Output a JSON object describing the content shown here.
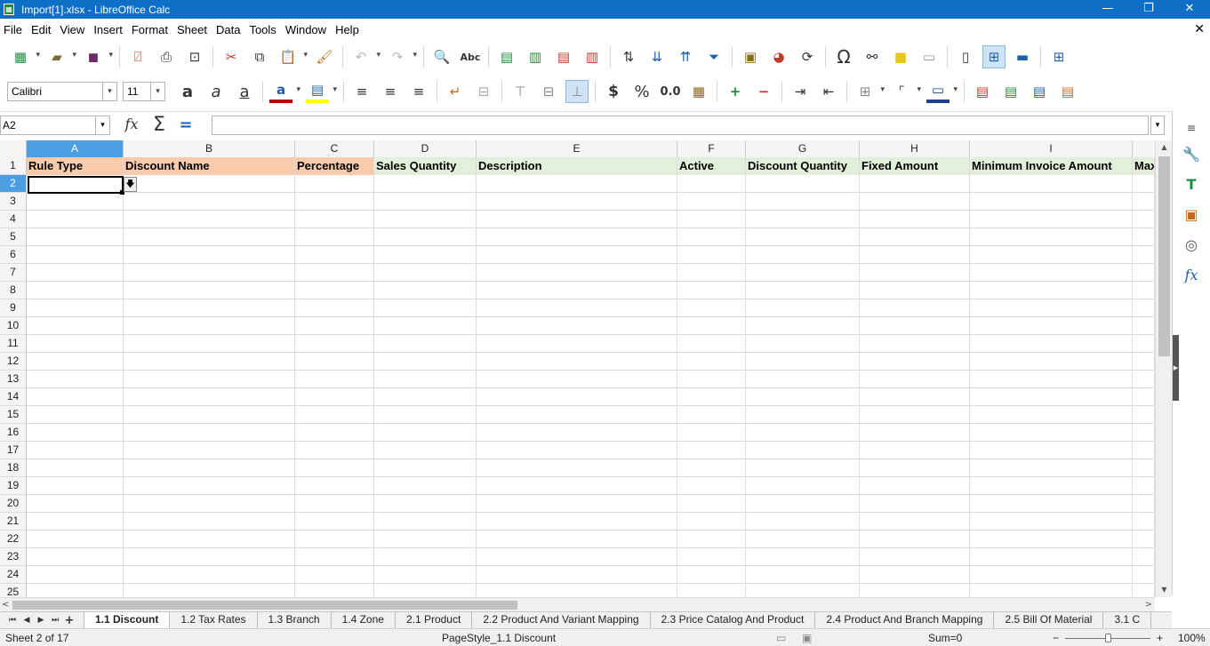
{
  "window": {
    "title": "Import[1].xlsx - LibreOffice Calc",
    "minimize": "—",
    "restore": "❐",
    "close": "✕"
  },
  "menu": {
    "items": [
      "File",
      "Edit",
      "View",
      "Insert",
      "Format",
      "Sheet",
      "Data",
      "Tools",
      "Window",
      "Help"
    ],
    "close_doc": "✕"
  },
  "toolbar2": {
    "font_name": "Calibri",
    "font_size": "11",
    "currency": "$",
    "percent": "%",
    "number": "0.0"
  },
  "formula_bar": {
    "name_box": "A2",
    "formula": ""
  },
  "columns": [
    "A",
    "B",
    "C",
    "D",
    "E",
    "F",
    "G",
    "H",
    "I"
  ],
  "header_row": [
    "Rule Type",
    "Discount Name",
    "Percentage",
    "Sales Quantity",
    "Description",
    "Active",
    "Discount Quantity",
    "Fixed Amount",
    "Minimum Invoice Amount",
    "Max"
  ],
  "row_numbers": [
    "1",
    "2",
    "3",
    "4",
    "5",
    "6",
    "7",
    "8",
    "9",
    "10",
    "11",
    "12",
    "13",
    "14",
    "15",
    "16",
    "17",
    "18",
    "19",
    "20",
    "21",
    "22",
    "23",
    "24",
    "25"
  ],
  "sheet_tabs": [
    "1.1 Discount",
    "1.2 Tax Rates",
    "1.3 Branch",
    "1.4 Zone",
    "2.1 Product",
    "2.2 Product And Variant Mapping",
    "2.3 Price Catalog And Product",
    "2.4 Product And Branch Mapping",
    "2.5 Bill Of Material",
    "3.1 C"
  ],
  "active_tab": "1.1 Discount",
  "status": {
    "sheet": "Sheet 2 of 17",
    "page_style": "PageStyle_1.1 Discount",
    "sum": "Sum=0",
    "zoom": "100%",
    "zoom_minus": "−",
    "zoom_plus": "+"
  },
  "colors": {
    "title_bar": "#0f6fc6",
    "header_peach": "#f8cbad",
    "header_green": "#e2efda",
    "selection": "#4c9ee3"
  }
}
